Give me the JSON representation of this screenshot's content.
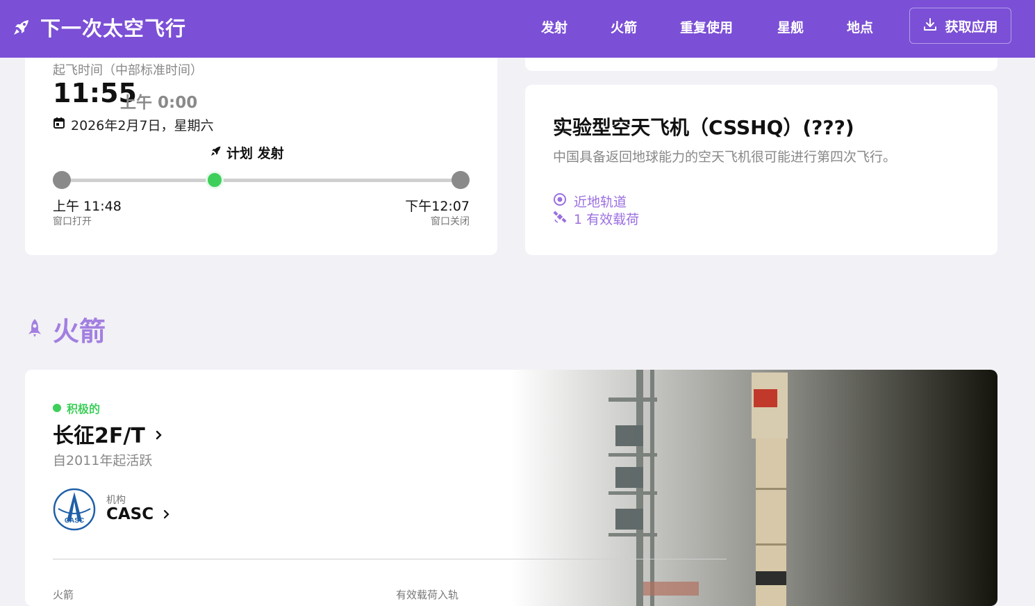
{
  "header": {
    "title": "下一次太空飞行",
    "nav": [
      "发射",
      "火箭",
      "重复使用",
      "星舰",
      "地点"
    ],
    "get_app": "获取应用"
  },
  "launch_time": {
    "liftoff_label": "起飞时间（中部标准时间）",
    "time": "11:55",
    "local_time": "上午 0:00",
    "date": "2026年2月7日，星期六",
    "planned_label": "计划 发射",
    "window_open_time": "上午 11:48",
    "window_open_label": "窗口打开",
    "window_close_time": "下午12:07",
    "window_close_label": "窗口关闭",
    "progress_fraction": 0.37
  },
  "mission": {
    "title": "实验型空天飞机（CSSHQ）(???)",
    "description": "中国具备返回地球能力的空天飞机很可能进行第四次飞行。",
    "orbit": "近地轨道",
    "payload": "1 有效载荷"
  },
  "rocket_section": {
    "title": "火箭",
    "status": "积极的",
    "name": "长征2F/T",
    "since": "自2011年起活跃",
    "agency_label": "机构",
    "agency_name": "CASC",
    "agency_logo_text": "CASC",
    "col_rocket": "火箭",
    "col_payload": "有效载荷入轨"
  },
  "colors": {
    "brand": "#7b4fd6",
    "accent_light": "#a27fe0",
    "status_green": "#3ecf5a"
  }
}
